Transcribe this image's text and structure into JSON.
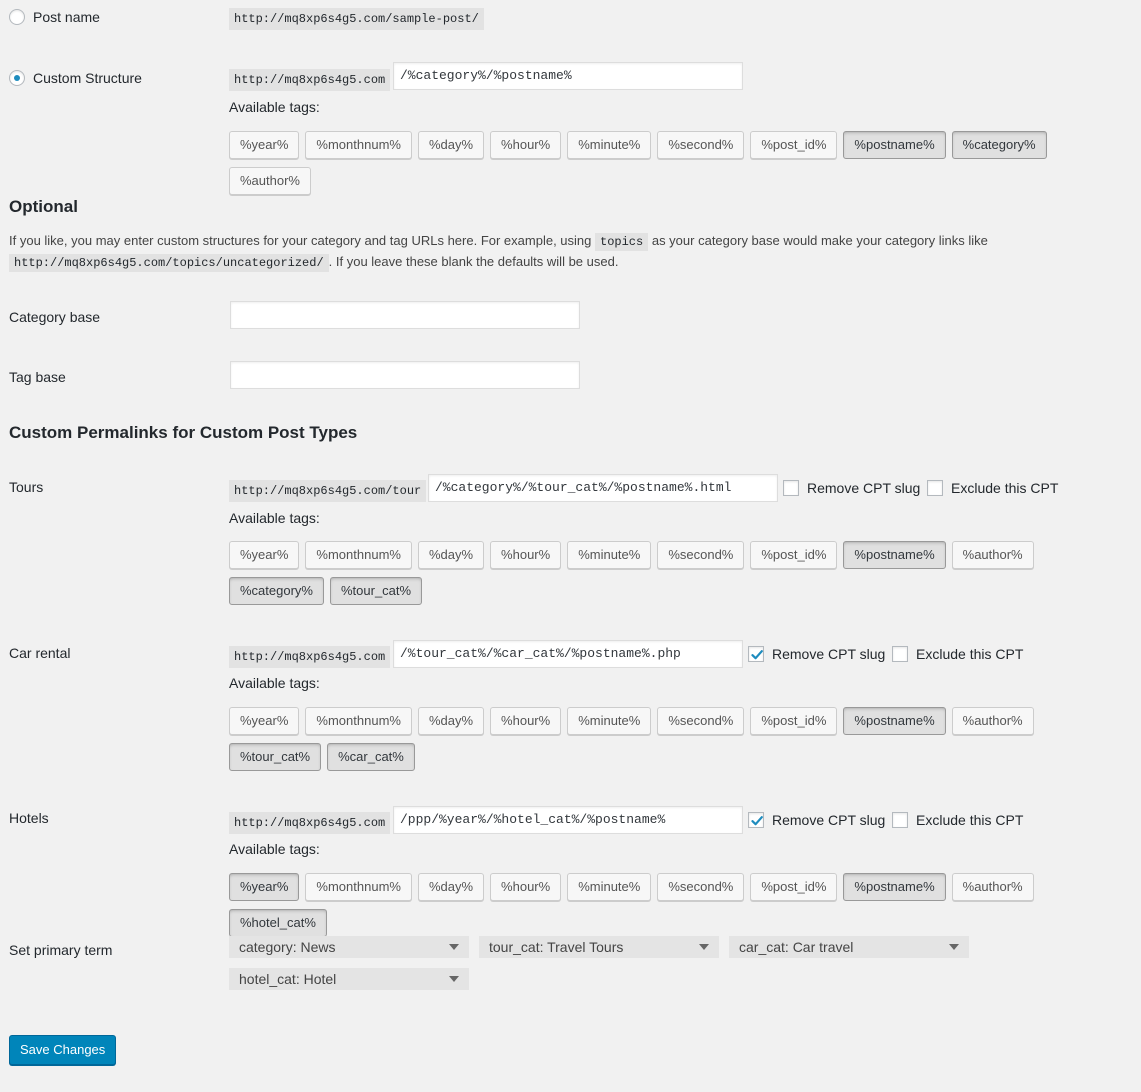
{
  "structure": {
    "post_name": {
      "label": "Post name",
      "example": "http://mq8xp6s4g5.com/sample-post/"
    },
    "custom": {
      "label": "Custom Structure",
      "prefix": "http://mq8xp6s4g5.com",
      "value": "/%category%/%postname%",
      "available_tags_label": "Available tags:",
      "tags": [
        {
          "label": "%year%",
          "active": false
        },
        {
          "label": "%monthnum%",
          "active": false
        },
        {
          "label": "%day%",
          "active": false
        },
        {
          "label": "%hour%",
          "active": false
        },
        {
          "label": "%minute%",
          "active": false
        },
        {
          "label": "%second%",
          "active": false
        },
        {
          "label": "%post_id%",
          "active": false
        },
        {
          "label": "%postname%",
          "active": true
        },
        {
          "label": "%category%",
          "active": true
        },
        {
          "label": "%author%",
          "active": false
        }
      ]
    }
  },
  "optional": {
    "heading": "Optional",
    "text1": "If you like, you may enter custom structures for your category and tag URLs here. For example, using",
    "code1": "topics",
    "text2": "as your category base would make your category links like",
    "code2": "http://mq8xp6s4g5.com/topics/uncategorized/",
    "text3": ". If you leave these blank the defaults will be used.",
    "category_base_label": "Category base",
    "tag_base_label": "Tag base"
  },
  "cpt": {
    "heading": "Custom Permalinks for Custom Post Types",
    "available_tags_label": "Available tags:",
    "remove_slug_label": "Remove CPT slug",
    "exclude_label": "Exclude this CPT",
    "types": [
      {
        "label": "Tours",
        "prefix": "http://mq8xp6s4g5.com/tour",
        "value": "/%category%/%tour_cat%/%postname%.html",
        "remove_slug": false,
        "exclude": false,
        "tags": [
          {
            "label": "%year%",
            "active": false
          },
          {
            "label": "%monthnum%",
            "active": false
          },
          {
            "label": "%day%",
            "active": false
          },
          {
            "label": "%hour%",
            "active": false
          },
          {
            "label": "%minute%",
            "active": false
          },
          {
            "label": "%second%",
            "active": false
          },
          {
            "label": "%post_id%",
            "active": false
          },
          {
            "label": "%postname%",
            "active": true
          },
          {
            "label": "%author%",
            "active": false
          },
          {
            "label": "%category%",
            "active": true
          },
          {
            "label": "%tour_cat%",
            "active": true
          }
        ]
      },
      {
        "label": "Car rental",
        "prefix": "http://mq8xp6s4g5.com",
        "value": "/%tour_cat%/%car_cat%/%postname%.php",
        "remove_slug": true,
        "exclude": false,
        "tags": [
          {
            "label": "%year%",
            "active": false
          },
          {
            "label": "%monthnum%",
            "active": false
          },
          {
            "label": "%day%",
            "active": false
          },
          {
            "label": "%hour%",
            "active": false
          },
          {
            "label": "%minute%",
            "active": false
          },
          {
            "label": "%second%",
            "active": false
          },
          {
            "label": "%post_id%",
            "active": false
          },
          {
            "label": "%postname%",
            "active": true
          },
          {
            "label": "%author%",
            "active": false
          },
          {
            "label": "%tour_cat%",
            "active": true
          },
          {
            "label": "%car_cat%",
            "active": true
          }
        ]
      },
      {
        "label": "Hotels",
        "prefix": "http://mq8xp6s4g5.com",
        "value": "/ppp/%year%/%hotel_cat%/%postname%",
        "remove_slug": true,
        "exclude": false,
        "tags": [
          {
            "label": "%year%",
            "active": true
          },
          {
            "label": "%monthnum%",
            "active": false
          },
          {
            "label": "%day%",
            "active": false
          },
          {
            "label": "%hour%",
            "active": false
          },
          {
            "label": "%minute%",
            "active": false
          },
          {
            "label": "%second%",
            "active": false
          },
          {
            "label": "%post_id%",
            "active": false
          },
          {
            "label": "%postname%",
            "active": true
          },
          {
            "label": "%author%",
            "active": false
          },
          {
            "label": "%hotel_cat%",
            "active": true
          }
        ]
      }
    ]
  },
  "primary_term": {
    "label": "Set primary term",
    "selects": [
      "category: News",
      "tour_cat: Travel Tours",
      "car_cat: Car travel",
      "hotel_cat: Hotel"
    ]
  },
  "save_label": "Save Changes",
  "colors": {
    "accent": "#0085ba",
    "radio_dot": "#1e8cbe",
    "checkmark": "#1e8cbe"
  }
}
